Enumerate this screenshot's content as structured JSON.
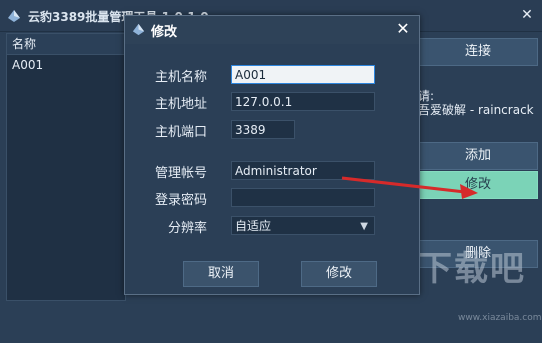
{
  "main_window": {
    "title": "云豹3389批量管理工具 1.0.1.0",
    "close_glyph": "✕",
    "list_header": "名称",
    "list_rows": [
      "A001"
    ],
    "buttons": {
      "connect": "连接",
      "add": "添加",
      "edit": "修改",
      "delete": "删除"
    },
    "hint_line1": "请:",
    "hint_line2": "吾爱破解 - raincrack"
  },
  "dialog": {
    "title": "修改",
    "close_glyph": "✕",
    "fields": {
      "host_name": {
        "label": "主机名称",
        "value": "A001"
      },
      "host_address": {
        "label": "主机地址",
        "value": "127.0.0.1"
      },
      "host_port": {
        "label": "主机端口",
        "value": "3389"
      },
      "account": {
        "label": "管理帐号",
        "value": "Administrator"
      },
      "password": {
        "label": "登录密码",
        "value": ""
      },
      "resolution": {
        "label": "分辨率",
        "value": "自适应"
      }
    },
    "buttons": {
      "cancel": "取消",
      "ok": "修改"
    }
  },
  "watermark": {
    "text": "下载吧",
    "subtext": "www.xiazaiba.com"
  },
  "colors": {
    "accent_green": "#7bd3b7",
    "arrow_red": "#d62a2a",
    "background": "#2b3f56"
  }
}
